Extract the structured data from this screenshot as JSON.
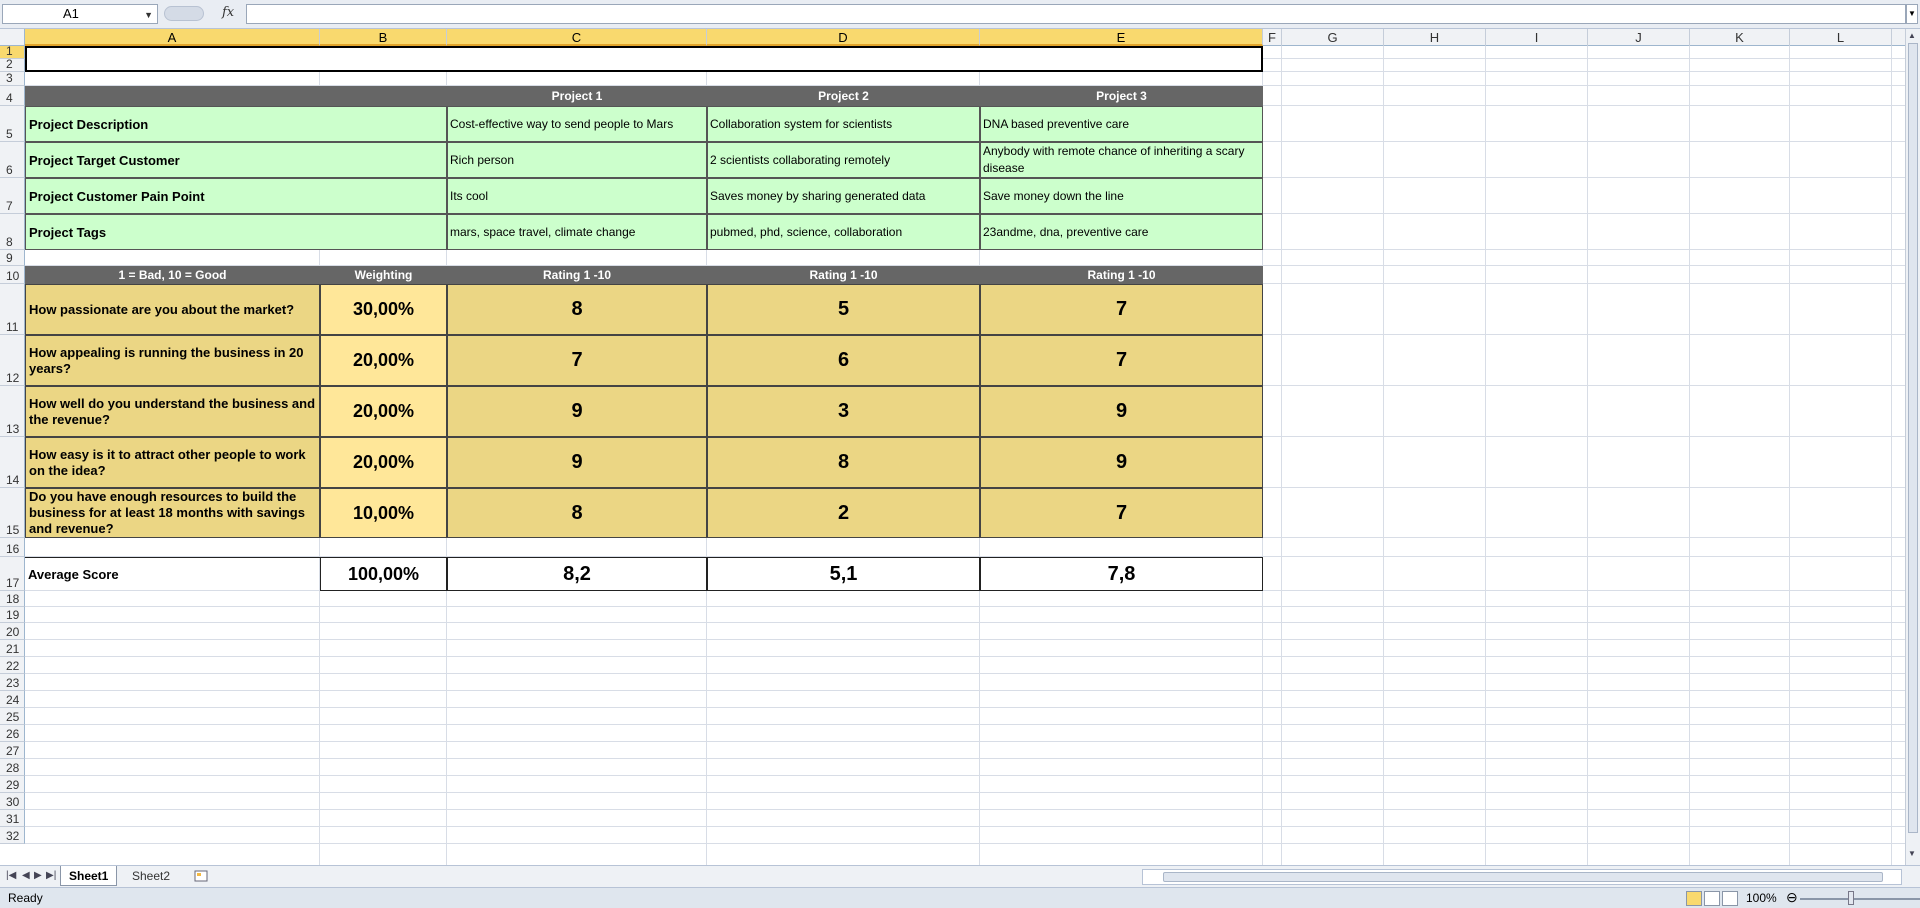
{
  "formula_bar": {
    "name_box": "A1",
    "fx": "fx",
    "formula": ""
  },
  "columns": [
    "A",
    "B",
    "C",
    "D",
    "E",
    "F",
    "G",
    "H",
    "I",
    "J",
    "K",
    "L"
  ],
  "rows": [
    "1",
    "2",
    "3",
    "4",
    "5",
    "6",
    "7",
    "8",
    "9",
    "10",
    "11",
    "12",
    "13",
    "14",
    "15",
    "16",
    "17",
    "18",
    "19",
    "20",
    "21",
    "22",
    "23",
    "24",
    "25",
    "26",
    "27",
    "28",
    "29",
    "30",
    "31",
    "32"
  ],
  "header_row": {
    "c": "Project 1",
    "d": "Project 2",
    "e": "Project 3"
  },
  "info": [
    {
      "label": "Project Description",
      "c": "Cost-effective way to send people to Mars",
      "d": "Collaboration system for scientists",
      "e": "DNA based preventive care"
    },
    {
      "label": "Project Target Customer",
      "c": "Rich person",
      "d": "2 scientists collaborating remotely",
      "e": "Anybody with remote chance of inheriting a scary disease"
    },
    {
      "label": "Project Customer Pain Point",
      "c": "Its cool",
      "d": "Saves money by sharing generated data",
      "e": "Save money down the line"
    },
    {
      "label": "Project Tags",
      "c": "mars, space travel, climate change",
      "d": "pubmed, phd, science, collaboration",
      "e": "23andme, dna, preventive care"
    }
  ],
  "rating_header": {
    "a": "1 = Bad, 10 = Good",
    "b": "Weighting",
    "c": "Rating 1 -10",
    "d": "Rating 1 -10",
    "e": "Rating 1 -10"
  },
  "questions": [
    {
      "q": "How passionate are you about the market?",
      "w": "30,00%",
      "c": "8",
      "d": "5",
      "e": "7"
    },
    {
      "q": "How appealing is running the business in 20 years?",
      "w": "20,00%",
      "c": "7",
      "d": "6",
      "e": "7"
    },
    {
      "q": "How well do you understand the business and the revenue?",
      "w": "20,00%",
      "c": "9",
      "d": "3",
      "e": "9"
    },
    {
      "q": "How easy is it to attract other people to work on the idea?",
      "w": "20,00%",
      "c": "9",
      "d": "8",
      "e": "9"
    },
    {
      "q": "Do you have enough resources to build the business for at least 18 months with savings and revenue?",
      "w": "10,00%",
      "c": "8",
      "d": "2",
      "e": "7"
    }
  ],
  "average": {
    "label": "Average Score",
    "w": "100,00%",
    "c": "8,2",
    "d": "5,1",
    "e": "7,8"
  },
  "sheet_tabs": [
    "Sheet1",
    "Sheet2"
  ],
  "status": {
    "text": "Ready",
    "zoom": "100%"
  }
}
